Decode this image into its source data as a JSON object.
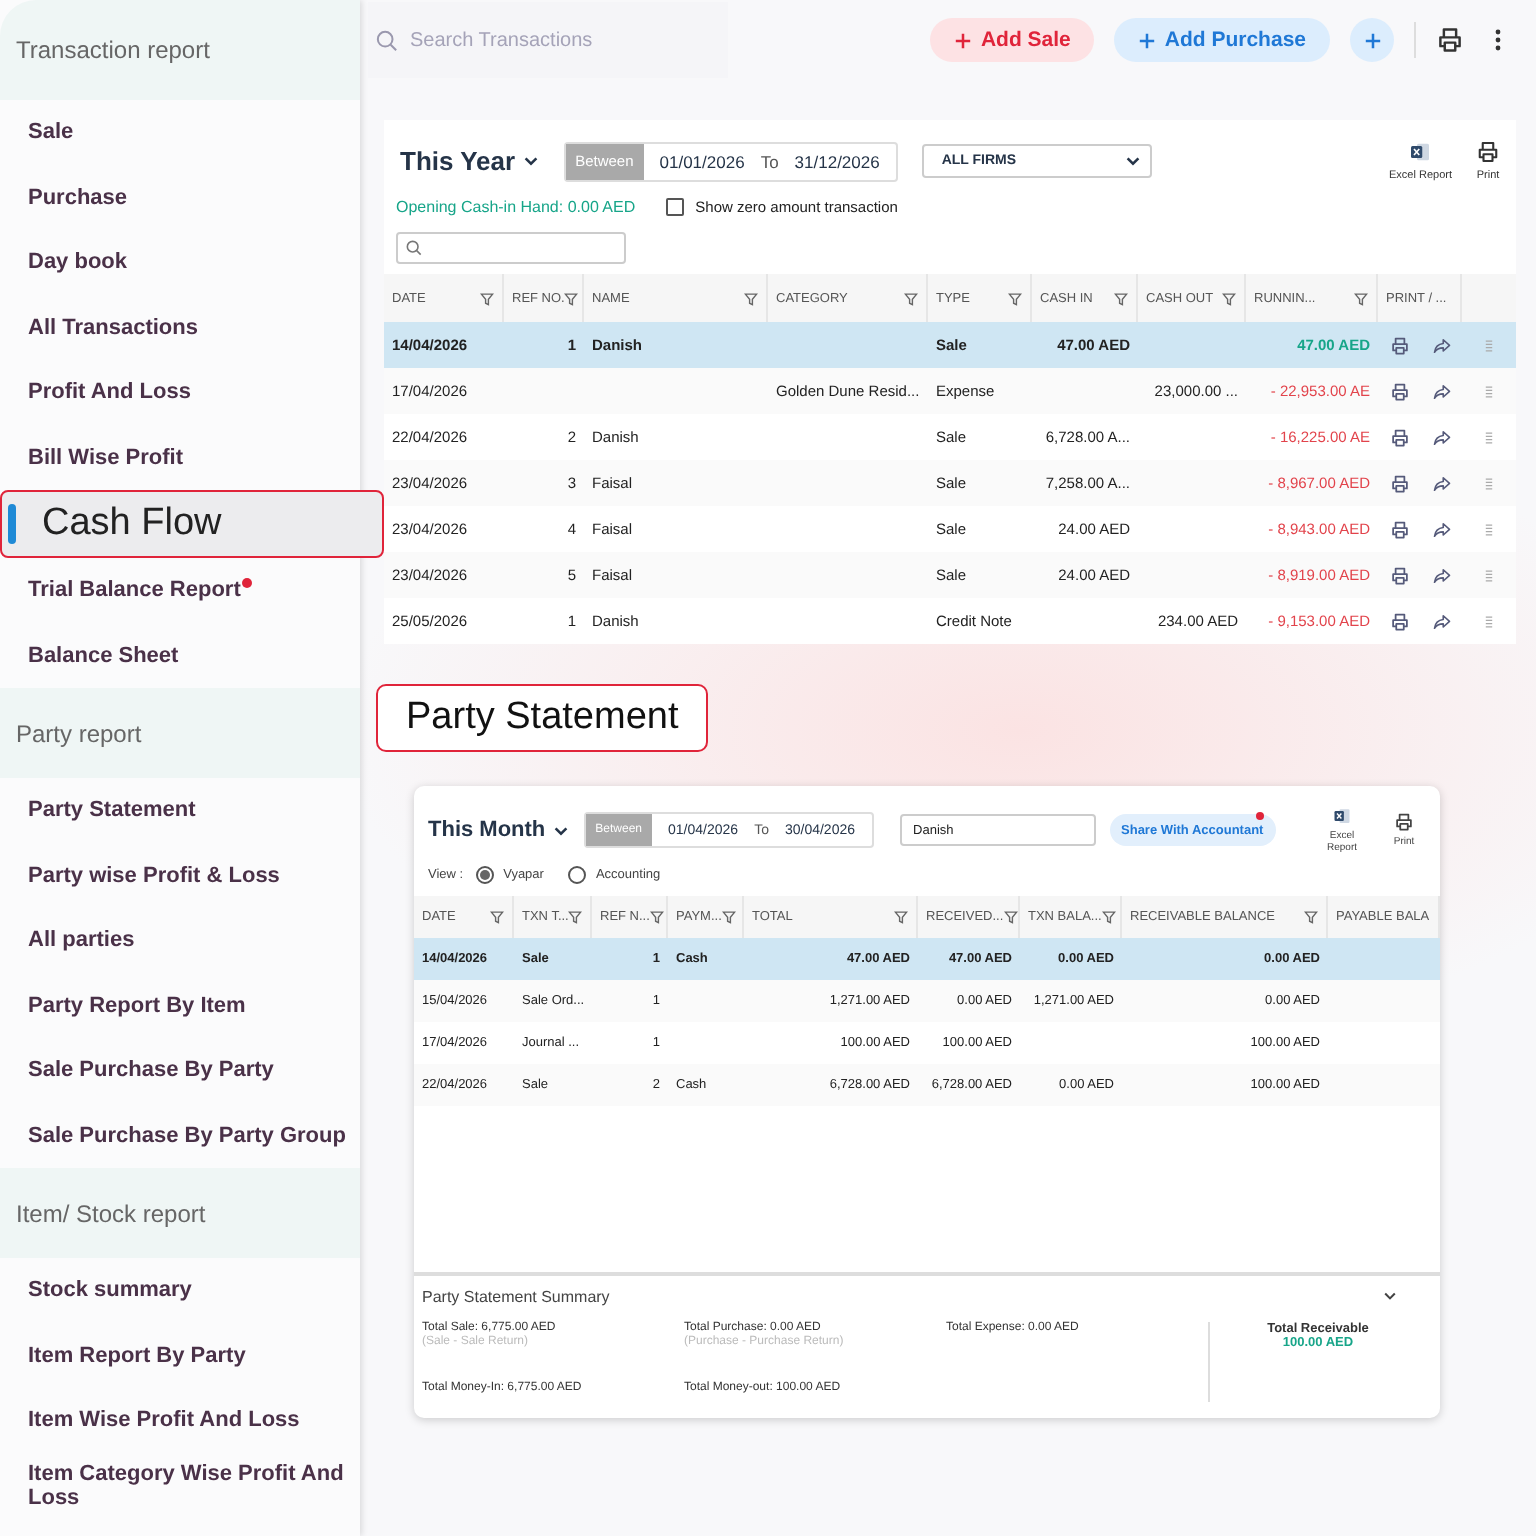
{
  "sidebar": {
    "sections": [
      {
        "title": "Transaction report",
        "items": [
          {
            "label": "Sale",
            "selected": false,
            "dot": false
          },
          {
            "label": "Purchase",
            "selected": false,
            "dot": false
          },
          {
            "label": "Day book",
            "selected": false,
            "dot": false
          },
          {
            "label": "All Transactions",
            "selected": false,
            "dot": false
          },
          {
            "label": "Profit And Loss",
            "selected": false,
            "dot": false
          },
          {
            "label": "Bill Wise Profit",
            "selected": false,
            "dot": false
          },
          {
            "label": "Cash Flow",
            "selected": true,
            "dot": false
          },
          {
            "label": "Trial Balance Report",
            "selected": false,
            "dot": true
          },
          {
            "label": "Balance Sheet",
            "selected": false,
            "dot": false
          }
        ]
      },
      {
        "title": "Party report",
        "items": [
          {
            "label": "Party Statement",
            "selected": false,
            "dot": false
          },
          {
            "label": "Party wise Profit & Loss",
            "selected": false,
            "dot": false
          },
          {
            "label": "All parties",
            "selected": false,
            "dot": false
          },
          {
            "label": "Party Report By Item",
            "selected": false,
            "dot": false
          },
          {
            "label": "Sale Purchase By Party",
            "selected": false,
            "dot": false
          },
          {
            "label": "Sale Purchase By Party Group",
            "selected": false,
            "dot": false
          }
        ]
      },
      {
        "title": "Item/ Stock report",
        "items": [
          {
            "label": "Stock summary",
            "selected": false,
            "dot": false
          },
          {
            "label": "Item Report By Party",
            "selected": false,
            "dot": false
          },
          {
            "label": "Item Wise Profit And Loss",
            "selected": false,
            "dot": false
          },
          {
            "label": "Item Category Wise Profit And Loss",
            "selected": false,
            "dot": false
          }
        ]
      }
    ]
  },
  "topbar": {
    "search": {
      "placeholder": "Search Transactions"
    },
    "add_sale": "Add Sale",
    "add_purchase": "Add Purchase"
  },
  "cash_flow": {
    "period": "This Year",
    "range": {
      "label": "Between",
      "from": "01/01/2026",
      "to_label": "To",
      "to": "31/12/2026"
    },
    "firm": "ALL FIRMS",
    "excel": "Excel Report",
    "print": "Print",
    "opening": "Opening Cash-in Hand: 0.00 AED",
    "zero_toggle": {
      "label": "Show zero amount transaction",
      "checked": false
    },
    "columns": [
      {
        "label": "DATE",
        "filter": true
      },
      {
        "label": "REF NO.",
        "filter": true
      },
      {
        "label": "NAME",
        "filter": true
      },
      {
        "label": "CATEGORY",
        "filter": true
      },
      {
        "label": "TYPE",
        "filter": true
      },
      {
        "label": "CASH IN",
        "filter": true
      },
      {
        "label": "CASH OUT",
        "filter": true
      },
      {
        "label": "RUNNIN...",
        "filter": true
      },
      {
        "label": "PRINT / ...",
        "filter": false
      }
    ],
    "rows": [
      {
        "date": "14/04/2026",
        "ref": "1",
        "name": "Danish",
        "type": "Sale",
        "cash_in": "47.00 AED",
        "running": "47.00 AED",
        "negative": false,
        "selected": true
      },
      {
        "date": "17/04/2026",
        "category": "Golden Dune Resid...",
        "type": "Expense",
        "cash_out": "23,000.00 ...",
        "running": "- 22,953.00 AE",
        "negative": true,
        "selected": false
      },
      {
        "date": "22/04/2026",
        "ref": "2",
        "name": "Danish",
        "type": "Sale",
        "cash_in": "6,728.00 A...",
        "running": "- 16,225.00 AE",
        "negative": true,
        "selected": false
      },
      {
        "date": "23/04/2026",
        "ref": "3",
        "name": "Faisal",
        "type": "Sale",
        "cash_in": "7,258.00 A...",
        "running": "- 8,967.00 AED",
        "negative": true,
        "selected": false
      },
      {
        "date": "23/04/2026",
        "ref": "4",
        "name": "Faisal",
        "type": "Sale",
        "cash_in": "24.00 AED",
        "running": "- 8,943.00 AED",
        "negative": true,
        "selected": false
      },
      {
        "date": "23/04/2026",
        "ref": "5",
        "name": "Faisal",
        "type": "Sale",
        "cash_in": "24.00 AED",
        "running": "- 8,919.00 AED",
        "negative": true,
        "selected": false
      },
      {
        "date": "25/05/2026",
        "ref": "1",
        "name": "Danish",
        "type": "Credit Note",
        "cash_out": "234.00 AED",
        "running": "- 9,153.00 AED",
        "negative": true,
        "selected": false
      }
    ]
  },
  "callout": "Party Statement",
  "party_statement": {
    "period": "This Month",
    "range": {
      "label": "Between",
      "from": "01/04/2026",
      "to_label": "To",
      "to": "30/04/2026"
    },
    "party": "Danish",
    "share": {
      "label": "Share With Accountant",
      "dot": true
    },
    "excel": "Excel Report",
    "print": "Print",
    "view": {
      "label": "View :",
      "options": [
        {
          "label": "Vyapar",
          "selected": true
        },
        {
          "label": "Accounting",
          "selected": false
        }
      ]
    },
    "columns": [
      {
        "label": "DATE",
        "filter": true
      },
      {
        "label": "TXN T...",
        "filter": true
      },
      {
        "label": "REF N...",
        "filter": true
      },
      {
        "label": "PAYM...",
        "filter": true
      },
      {
        "label": "TOTAL",
        "filter": true
      },
      {
        "label": "RECEIVED...",
        "filter": true
      },
      {
        "label": "TXN BALA...",
        "filter": true
      },
      {
        "label": "RECEIVABLE BALANCE",
        "filter": true
      },
      {
        "label": "PAYABLE BALA",
        "filter": false
      }
    ],
    "rows": [
      {
        "date": "14/04/2026",
        "txn_type": "Sale",
        "ref": "1",
        "payment": "Cash",
        "total": "47.00 AED",
        "received": "47.00 AED",
        "txn_balance": "0.00 AED",
        "receivable": "0.00 AED",
        "selected": true
      },
      {
        "date": "15/04/2026",
        "txn_type": "Sale Ord...",
        "ref": "1",
        "total": "1,271.00 AED",
        "received": "0.00 AED",
        "txn_balance": "1,271.00 AED",
        "receivable": "0.00 AED",
        "selected": false
      },
      {
        "date": "17/04/2026",
        "txn_type": "Journal ...",
        "ref": "1",
        "total": "100.00 AED",
        "received": "100.00 AED",
        "receivable": "100.00 AED",
        "selected": false
      },
      {
        "date": "22/04/2026",
        "txn_type": "Sale",
        "ref": "2",
        "payment": "Cash",
        "total": "6,728.00 AED",
        "received": "6,728.00 AED",
        "txn_balance": "0.00 AED",
        "receivable": "100.00 AED",
        "selected": false
      }
    ],
    "summary": {
      "title": "Party Statement Summary",
      "items": [
        {
          "label": "Total Sale: 6,775.00 AED",
          "note": "(Sale - Sale Return)"
        },
        {
          "label": "Total Purchase: 0.00 AED",
          "note": "(Purchase - Purchase Return)"
        },
        {
          "label": "Total Expense: 0.00 AED"
        },
        {
          "label": "Total Money-In: 6,775.00 AED"
        },
        {
          "label": "Total Money-out: 100.00 AED"
        }
      ],
      "total_label": "Total Receivable",
      "total_value": "100.00 AED"
    }
  }
}
